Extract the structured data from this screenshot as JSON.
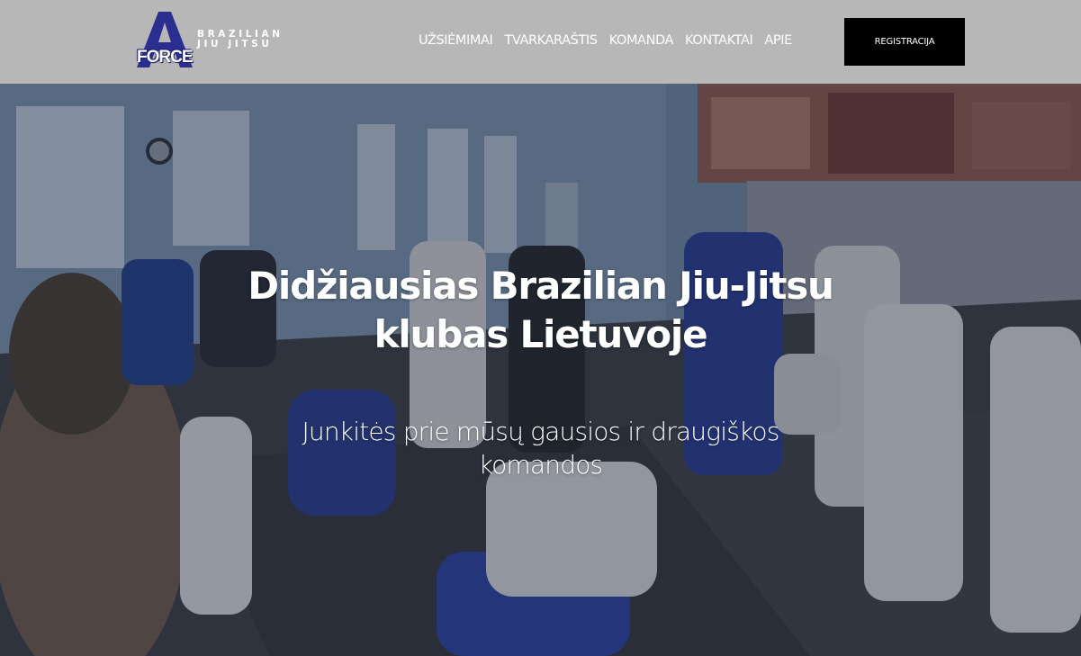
{
  "logo": {
    "mark_letter": "A",
    "mark_word": "FORCE",
    "line1": "BRAZILIAN",
    "line2": "JIU JITSU"
  },
  "nav": {
    "items": [
      {
        "label": "UŽSIĖMIMAI"
      },
      {
        "label": "TVARKARAŠTIS"
      },
      {
        "label": "KOMANDA"
      },
      {
        "label": "KONTAKTAI"
      },
      {
        "label": "APIE"
      }
    ],
    "cta": "REGISTRACIJA"
  },
  "hero": {
    "title": "Didžiausias Brazilian Jiu-Jitsu klubas Lietuvoje",
    "subtitle": "Junkitės prie mūsų gausios ir draugiškos komandos"
  },
  "colors": {
    "header_bg": "#b7b7b7",
    "cta_bg": "#000000",
    "brand_blue": "#2a2f8f",
    "text_light": "#ffffff"
  }
}
